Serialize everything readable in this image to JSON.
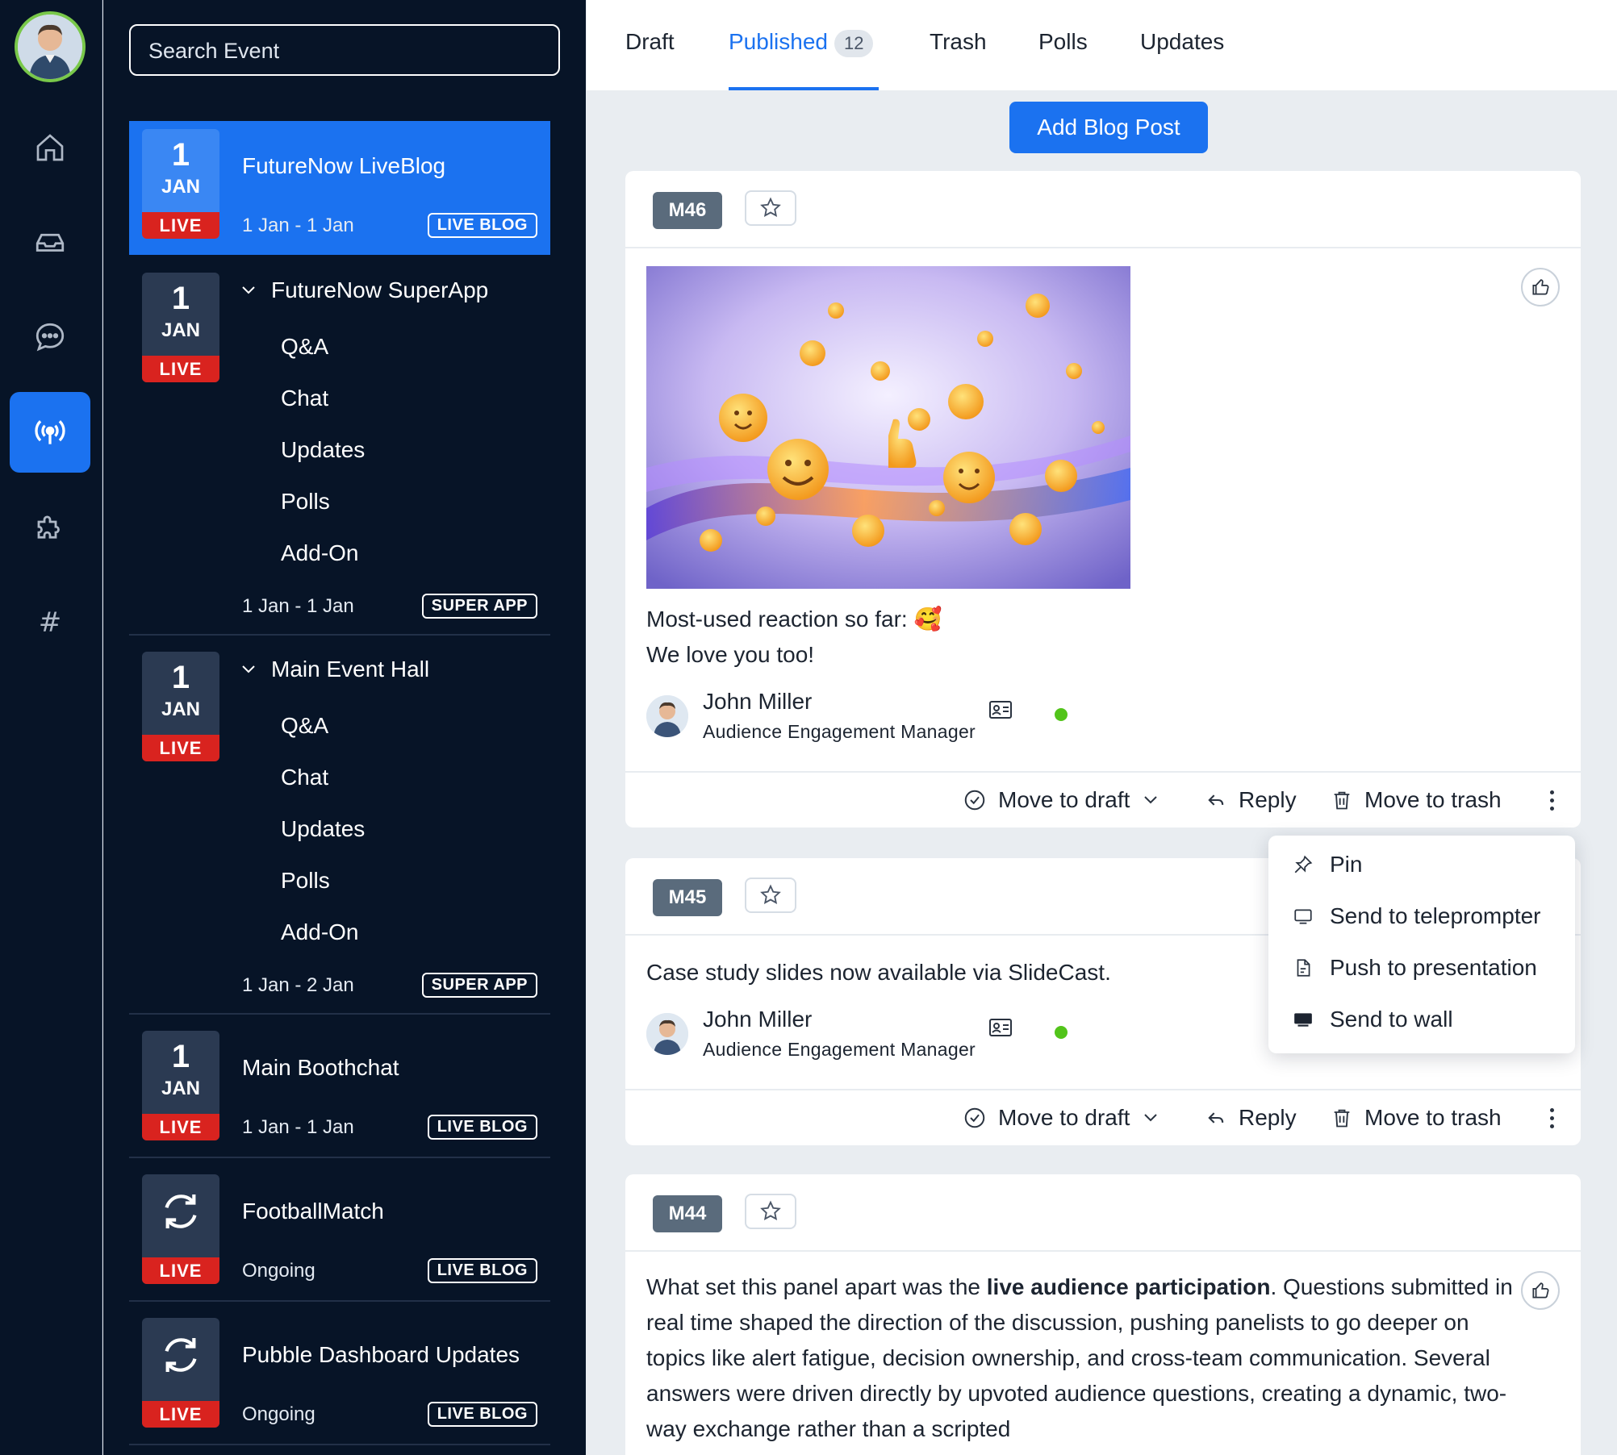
{
  "search": {
    "placeholder": "Search Event"
  },
  "events": [
    {
      "day": "1",
      "month": "JAN",
      "status": "LIVE",
      "title": "FutureNow LiveBlog",
      "dates": "1 Jan - 1 Jan",
      "tag": "LIVE BLOG",
      "selected": true
    },
    {
      "day": "1",
      "month": "JAN",
      "status": "LIVE",
      "title": "FutureNow SuperApp",
      "dates": "1 Jan - 1 Jan",
      "tag": "SUPER APP",
      "expanded": true,
      "subitems": [
        "Q&A",
        "Chat",
        "Updates",
        "Polls",
        "Add-On"
      ]
    },
    {
      "day": "1",
      "month": "JAN",
      "status": "LIVE",
      "title": "Main Event Hall",
      "dates": "1 Jan - 2 Jan",
      "tag": "SUPER APP",
      "expanded": true,
      "subitems": [
        "Q&A",
        "Chat",
        "Updates",
        "Polls",
        "Add-On"
      ]
    },
    {
      "day": "1",
      "month": "JAN",
      "status": "LIVE",
      "title": "Main Boothchat",
      "dates": "1 Jan - 1 Jan",
      "tag": "LIVE BLOG"
    },
    {
      "status": "LIVE",
      "title": "FootballMatch",
      "dates": "Ongoing",
      "tag": "LIVE BLOG",
      "icon": "sync-icon"
    },
    {
      "status": "LIVE",
      "title": "Pubble Dashboard Updates",
      "dates": "Ongoing",
      "tag": "LIVE BLOG",
      "icon": "sync-icon"
    }
  ],
  "tabs": [
    {
      "label": "Draft"
    },
    {
      "label": "Published",
      "count": "12",
      "active": true
    },
    {
      "label": "Trash"
    },
    {
      "label": "Polls"
    },
    {
      "label": "Updates"
    }
  ],
  "add_button": "Add Blog Post",
  "posts": [
    {
      "id": "M46",
      "image": "emoji-reactions-image",
      "lines": [
        "Most-used reaction so far: 🥰",
        "We love you too!"
      ],
      "author": {
        "name": "John Miller",
        "role": "Audience Engagement Manager"
      }
    },
    {
      "id": "M45",
      "lines": [
        "Case study slides now available via SlideCast."
      ],
      "author": {
        "name": "John Miller",
        "role": "Audience Engagement Manager"
      }
    },
    {
      "id": "M44",
      "text_before": "What set this panel apart was the ",
      "text_bold": "live audience participation",
      "text_after": ". Questions submitted in real time shaped the direction of the discussion, pushing panelists to go deeper on topics like alert fatigue, decision ownership, and cross-team communication. Several answers were driven directly by upvoted audience questions, creating a dynamic, two-way exchange rather than a scripted"
    }
  ],
  "post_actions": {
    "draft": "Move to draft",
    "reply": "Reply",
    "trash": "Move to trash"
  },
  "menu": [
    "Pin",
    "Send to teleprompter",
    "Push to presentation",
    "Send to wall"
  ],
  "colors": {
    "accent": "#1b72f0",
    "sidebar": "#071427",
    "live": "#d9231f",
    "online": "#52c41a"
  }
}
